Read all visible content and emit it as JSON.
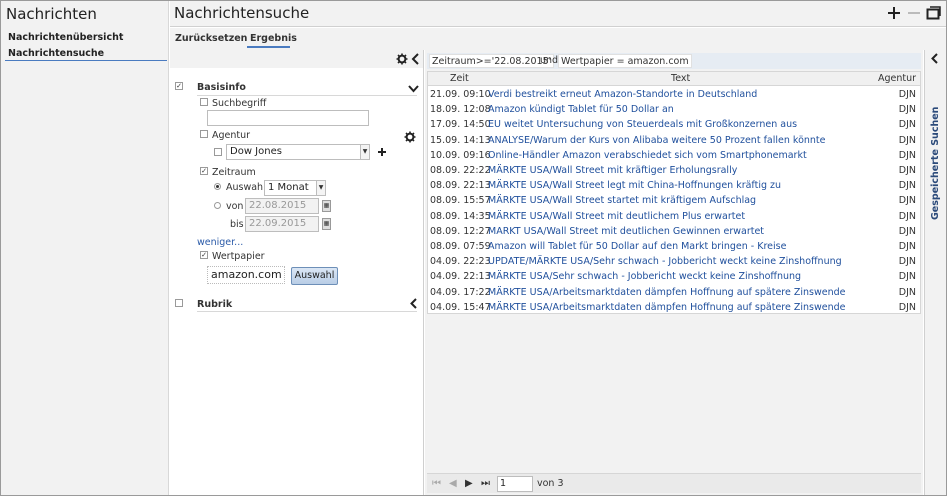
{
  "nav": {
    "title": "Nachrichten",
    "items": [
      {
        "label": "Nachrichtenübersicht"
      },
      {
        "label": "Nachrichtensuche"
      }
    ]
  },
  "header": {
    "title": "Nachrichtensuche",
    "icons": [
      "plus-icon",
      "minus-icon",
      "window-icon"
    ]
  },
  "tabs": [
    {
      "label": "Zurücksetzen"
    },
    {
      "label": "Ergebnis",
      "active": true
    }
  ],
  "filter": {
    "basisinfo": {
      "title": "Basisinfo",
      "checked": true,
      "suchbegriff": {
        "label": "Suchbegriff",
        "checked": false,
        "value": ""
      },
      "agentur": {
        "label": "Agentur",
        "checked": false,
        "sub_checked": false,
        "value": "Dow Jones"
      },
      "zeitraum": {
        "label": "Zeitraum",
        "checked": true,
        "auswahl_label": "Auswahl",
        "auswahl_value": "1 Monat",
        "von_label": "von",
        "von_value": "22.08.2015",
        "bis_label": "bis",
        "bis_value": "22.09.2015"
      },
      "weniger_link": "weniger...",
      "wertpapier": {
        "label": "Wertpapier",
        "checked": true,
        "value": "amazon.com",
        "button": "Auswahl"
      }
    },
    "rubrik": {
      "title": "Rubrik",
      "checked": false
    }
  },
  "query": {
    "chips": [
      "Zeitraum>='22.08.2015'",
      "Wertpapier = amazon.com"
    ],
    "connector": "und"
  },
  "table": {
    "columns": {
      "time": "Zeit",
      "text": "Text",
      "agency": "Agentur"
    },
    "rows": [
      {
        "time": "21.09. 09:10",
        "text": "Verdi bestreikt erneut Amazon-Standorte in Deutschland",
        "agency": "DJN"
      },
      {
        "time": "18.09. 12:08",
        "text": "Amazon kündigt Tablet für 50 Dollar an",
        "agency": "DJN"
      },
      {
        "time": "17.09. 14:50",
        "text": "EU weitet Untersuchung von Steuerdeals mit Großkonzernen aus",
        "agency": "DJN"
      },
      {
        "time": "15.09. 14:13",
        "text": "ANALYSE/Warum der Kurs von Alibaba weitere 50 Prozent fallen könnte",
        "agency": "DJN"
      },
      {
        "time": "10.09. 09:16",
        "text": "Online-Händler Amazon verabschiedet sich vom Smartphonemarkt",
        "agency": "DJN"
      },
      {
        "time": "08.09. 22:22",
        "text": "MÄRKTE USA/Wall Street mit kräftiger Erholungsrally",
        "agency": "DJN"
      },
      {
        "time": "08.09. 22:13",
        "text": "MÄRKTE USA/Wall Street legt mit China-Hoffnungen kräftig zu",
        "agency": "DJN"
      },
      {
        "time": "08.09. 15:57",
        "text": "MÄRKTE USA/Wall Street startet mit kräftigem Aufschlag",
        "agency": "DJN"
      },
      {
        "time": "08.09. 14:35",
        "text": "MÄRKTE USA/Wall Street mit deutlichem Plus erwartet",
        "agency": "DJN"
      },
      {
        "time": "08.09. 12:27",
        "text": "MARKT USA/Wall Street mit deutlichen Gewinnen erwartet",
        "agency": "DJN"
      },
      {
        "time": "08.09. 07:59",
        "text": "Amazon will Tablet für 50 Dollar auf den Markt bringen - Kreise",
        "agency": "DJN"
      },
      {
        "time": "04.09. 22:23",
        "text": "UPDATE/MÄRKTE USA/Sehr schwach - Jobbericht weckt keine Zinshoffnung",
        "agency": "DJN"
      },
      {
        "time": "04.09. 22:13",
        "text": "MÄRKTE USA/Sehr schwach - Jobbericht weckt keine Zinshoffnung",
        "agency": "DJN"
      },
      {
        "time": "04.09. 17:22",
        "text": "MÄRKTE USA/Arbeitsmarktdaten dämpfen Hoffnung auf spätere Zinswende",
        "agency": "DJN"
      },
      {
        "time": "04.09. 15:47",
        "text": "MÄRKTE USA/Arbeitsmarktdaten dämpfen Hoffnung auf spätere Zinswende",
        "agency": "DJN"
      }
    ]
  },
  "pager": {
    "page": "1",
    "of": "von 3"
  },
  "rail": {
    "label": "Gespeicherte Suchen"
  },
  "colors": {
    "accent": "#4a7bc0",
    "link": "#1f4f9c",
    "panel": "#f2f2f2"
  }
}
